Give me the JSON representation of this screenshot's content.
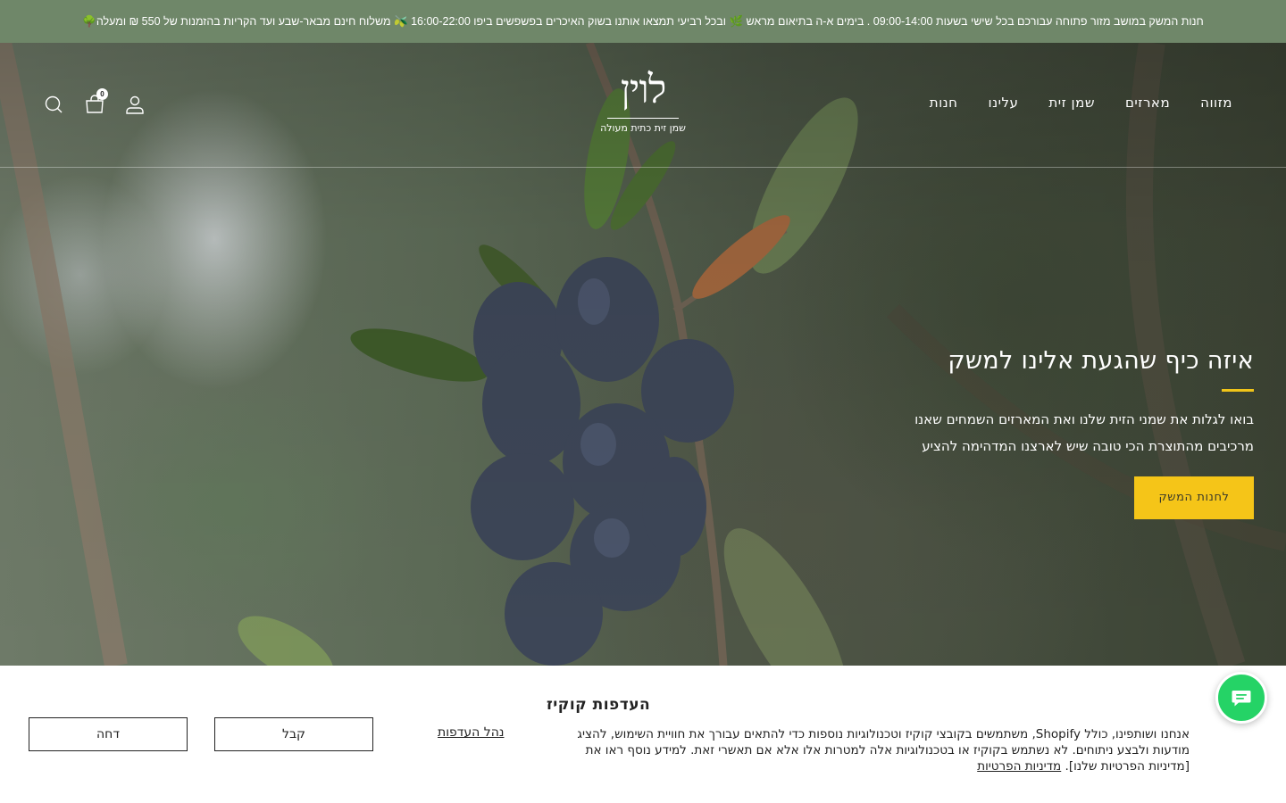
{
  "announcement": {
    "text": "חנות המשק במושב מזור פתוחה עבורכם בכל שישי בשעות 09:00-14:00 . בימים א-ה בתיאום מראש 🌿 ובכל רביעי תמצאו אותנו בשוק האיכרים בפשפשים ביפו 16:00-22:00 🫒 משלוח חינם מבאר-שבע ועד הקריות בהזמנות של 550 ₪ ומעלה🌳"
  },
  "header": {
    "logo_mark": "לוין",
    "logo_tagline": "שמן זית כתית מעולה",
    "nav": [
      {
        "label": "חנות"
      },
      {
        "label": "עלינו"
      },
      {
        "label": "שמן זית"
      },
      {
        "label": "מארזים"
      },
      {
        "label": "מזווה"
      }
    ],
    "cart_count": "0",
    "icons": [
      "search-icon",
      "cart-icon",
      "account-icon"
    ]
  },
  "hero": {
    "title": "איזה כיף שהגעת אלינו למשק",
    "line1": "בואו לגלות את שמני הזית שלנו ואת המארזים השמחים שאנו",
    "line2": "מרכיבים מהתוצרת הכי טובה שיש לארצנו המדהימה להציע",
    "cta": "לחנות המשק",
    "accent_color": "#f5c518"
  },
  "cookie": {
    "title": "העדפות קוקיז",
    "body": "אנחנו ושותפינו, כולל Shopify, משתמשים בקובצי קוקיז וטכנולוגיות נוספות כדי להתאים עבורך את חוויית השימוש, להציג מודעות ולבצע ניתוחים. לא נשתמש בקוקיז או בטכנולוגיות אלה למטרות אלו אלא אם תאשרי זאת. למידע נוסף ראו את [מדיניות הפרטיות שלנו].",
    "privacy_link": "מדיניות הפרטיות",
    "manage": "נהל העדפות",
    "accept": "קבל",
    "decline": "דחה"
  },
  "colors": {
    "announcement_bg": "#6f8769",
    "chat_green": "#25d366"
  }
}
